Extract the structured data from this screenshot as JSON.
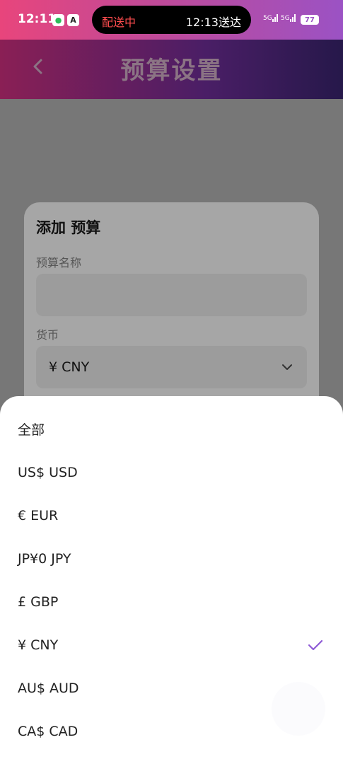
{
  "status_bar": {
    "time": "12:11",
    "island_left": "配送中",
    "island_right": "12:13送达",
    "signal_1": "5G",
    "signal_2": "5G",
    "battery": "77"
  },
  "header": {
    "title": "预算设置",
    "back_icon": "chevron-left-icon"
  },
  "form": {
    "title": "添加 预算",
    "name_label": "预算名称",
    "name_value": "",
    "currency_label": "货币",
    "currency_value": "¥ CNY"
  },
  "currency_sheet": {
    "options": [
      {
        "label": "全部",
        "selected": false
      },
      {
        "label": "US$ USD",
        "selected": false
      },
      {
        "label": "€ EUR",
        "selected": false
      },
      {
        "label": "JP¥0 JPY",
        "selected": false
      },
      {
        "label": "£ GBP",
        "selected": false
      },
      {
        "label": "¥ CNY",
        "selected": true
      },
      {
        "label": "AU$ AUD",
        "selected": false
      },
      {
        "label": "CA$ CAD",
        "selected": false
      }
    ],
    "check_color": "#8e5ad6"
  },
  "colors": {
    "status_gradient_start": "#e8457c",
    "status_gradient_end": "#9b52c4",
    "island_red": "#ff4d4f"
  }
}
